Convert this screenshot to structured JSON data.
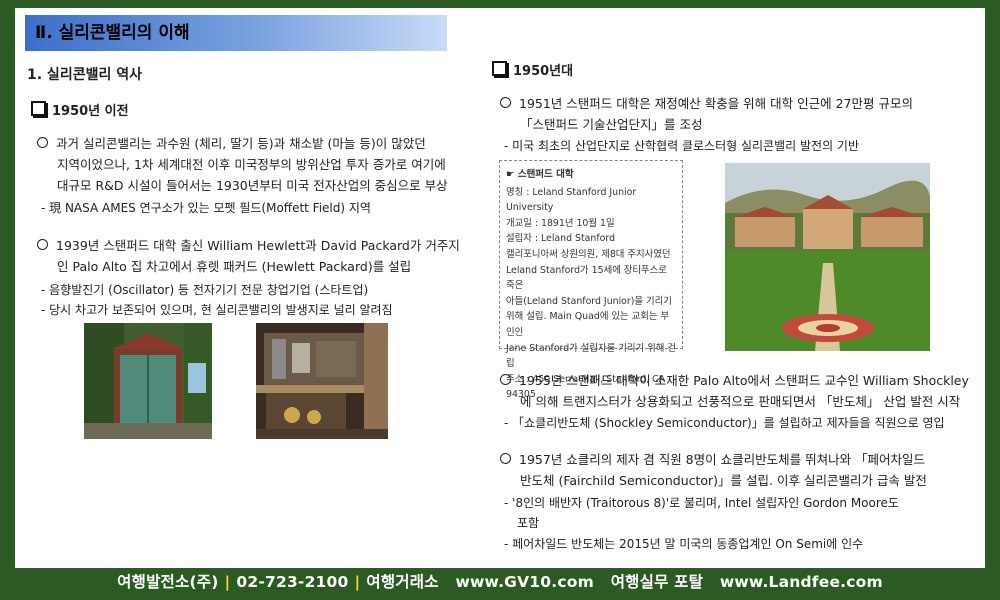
{
  "header": {
    "title": "Ⅱ. 실리콘밸리의 이해"
  },
  "left": {
    "section_title": "1. 실리콘밸리 역사",
    "subheading": "1950년 이전",
    "p1_lines": [
      "과거 실리콘밸리는 과수원 (체리, 딸기 등)과 채소밭 (마늘 등)이 많았던",
      "지역이었으나, 1차 세계대전 이후 미국정부의 방위산업 투자 증가로 여기에",
      "대규모 R&D 시설이 들어서는 1930년부터 미국 전자산업의 중심으로 부상"
    ],
    "p1_dash": "- 現 NASA AMES 연구소가 있는 모펫 필드(Moffett Field) 지역",
    "p2_lines": [
      "1939년 스탠퍼드 대학 출신 William Hewlett과 David Packard가 거주지",
      "인 Palo Alto 집 차고에서 휴렛 패커드 (Hewlett Packard)를 설립"
    ],
    "p2_dash1": "- 음향발진기 (Oscillator) 등 전자기기 전문 창업기업 (스타트업)",
    "p2_dash2": "- 당시 차고가 보존되어 있으며, 현 실리콘밸리의 발생지로 널리 알려짐"
  },
  "right": {
    "subheading": "1950년대",
    "p1_lines": [
      "1951년 스탠퍼드 대학은 재정예산 확충을 위해 대학 인근에 27만평 규모의",
      "「스탠퍼드 기술산업단지」를 조성"
    ],
    "p1_dash": "- 미국 최초의 산업단지로 산학협력 클로스터형 실리콘밸리 발전의 기반",
    "infobox": {
      "title": "☛ 스탠퍼드 대학",
      "lines": [
        "명칭 : Leland Stanford Junior University",
        "개교일 : 1891년 10월 1일",
        "설립자 : Leland Stanford",
        "캘리포니아써 상원의원, 제8대 주지사였던",
        "Leland Stanford가 15세에 장티푸스로 죽은",
        "아들(Leland Stanford Junior)을 기리기",
        "위해 설립. Main Quad에 있는 교회는 부인인",
        "Jane Stanford가 설립자를 기리기 위해 건립",
        "주소 : 450 Serra Mall, Stanford, CA 94305"
      ]
    },
    "p2_lines": [
      "1955년 스탠퍼드 대학이 소재한 Palo Alto에서 스탠퍼드 교수인 William Shockley",
      "에 의해 트랜지스터가 상용화되고 선풍적으로 판매되면서 「반도체」 산업 발전 시작"
    ],
    "p2_dash": "- 「쇼클리반도체 (Shockley Semiconductor)」를 설립하고 제자들을 직원으로 영입",
    "p3_lines": [
      "1957년 쇼클리의 제자 겸 직원 8명이 쇼클리반도체를 뛰쳐나와 「페어차일드",
      "반도체 (Fairchild Semiconductor)」를 설립. 이후 실리콘밸리가 급속 발전"
    ],
    "p3_dash1": "- '8인의 배반자 (Traitorous 8)'로 불리며, Intel 설립자인 Gordon Moore도",
    "p3_dash1b": "포함",
    "p3_dash2": "- 페어차일드 반도체는 2015년 말 미국의 동종업계인 On Semi에 인수"
  },
  "footer": {
    "company": "여행발전소(주)",
    "phone": "02-723-2100",
    "agency": "여행거래소",
    "site1": "www.GV10.com",
    "portal": "여행실무 포탈",
    "site2": "www.Landfee.com"
  }
}
